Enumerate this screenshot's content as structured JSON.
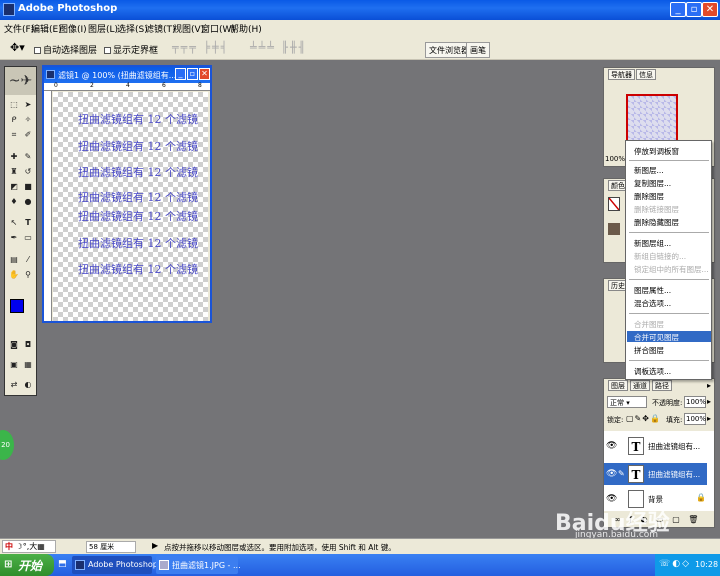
{
  "app": {
    "title": "Adobe Photoshop",
    "icon": "photoshop-icon"
  },
  "menubar": [
    "文件(F)",
    "编辑(E)",
    "图像(I)",
    "图层(L)",
    "选择(S)",
    "滤镜(T)",
    "视图(V)",
    "窗口(W)",
    "帮助(H)"
  ],
  "options": {
    "auto_select_layer": "自动选择图层",
    "show_bounding_box": "显示定界框",
    "tab_file_browser": "文件浏览器",
    "tab_brushes": "画笔"
  },
  "document": {
    "title": "滤镜1 @ 100% (扭曲滤镜组有...",
    "ruler_top": [
      "0",
      "2",
      "4",
      "6",
      "8"
    ],
    "lines": [
      "扭曲滤镜组有 12 个滤镜",
      "扭曲滤镜组有 12 个滤镜",
      "扭曲滤镜组有 12 个滤镜",
      "扭曲滤镜组有 12 个滤镜",
      "扭曲滤镜组有 12 个滤镜",
      "扭曲滤镜组有 12 个滤镜",
      "扭曲滤镜组有 12 个滤镜"
    ]
  },
  "navigator": {
    "tab_navigator": "导航器",
    "tab_info": "信息",
    "zoom": "100%"
  },
  "color_panel": {
    "tab_color": "颜色"
  },
  "history_panel": {
    "tab_history": "历史"
  },
  "context_menu": {
    "items": [
      {
        "label": "停放到调板窗",
        "disabled": false
      },
      {
        "label": "新图层...",
        "disabled": false
      },
      {
        "label": "复制图层...",
        "disabled": false
      },
      {
        "label": "删除图层",
        "disabled": false
      },
      {
        "label": "删除链接图层",
        "disabled": true
      },
      {
        "label": "删除隐藏图层",
        "disabled": false
      },
      {
        "label": "新图层组...",
        "disabled": false
      },
      {
        "label": "新组自链接的...",
        "disabled": true
      },
      {
        "label": "锁定组中的所有图层...",
        "disabled": true
      },
      {
        "label": "图层属性...",
        "disabled": false
      },
      {
        "label": "混合选项...",
        "disabled": false
      },
      {
        "label": "合并图层",
        "disabled": true
      },
      {
        "label": "合并可见图层",
        "disabled": false,
        "highlighted": true
      },
      {
        "label": "拼合图层",
        "disabled": false
      },
      {
        "label": "调板选项...",
        "disabled": false
      }
    ]
  },
  "layers_panel": {
    "tab_layers": "图层",
    "tab_channels": "通道",
    "tab_paths": "路径",
    "blend_mode": "正常",
    "opacity_label": "不透明度:",
    "opacity_value": "100%",
    "lock_label": "锁定:",
    "fill_label": "填充:",
    "fill_value": "100%",
    "layers": [
      {
        "name": "扭曲滤镜组有...",
        "type": "T",
        "selected": false
      },
      {
        "name": "扭曲滤镜组有...",
        "type": "T",
        "selected": true
      },
      {
        "name": "背景",
        "type": "",
        "selected": false
      }
    ]
  },
  "statusbar": {
    "zoom": "58 厘米",
    "hint": "点按并拖移以移动图层或选区。要用附加选项，使用 Shift 和 Alt 键。",
    "ime": "中"
  },
  "taskbar": {
    "start": "开始",
    "items": [
      "Adobe Photoshop",
      "扭曲滤镜1.JPG - ..."
    ],
    "clock": "10:28"
  },
  "watermark": {
    "text": "Baidu经验",
    "url": "jingyan.baidu.com"
  },
  "floating_badge": "20",
  "colors": {
    "titlebar": "#0a5ae6",
    "canvas_text": "#4a4ac8",
    "foreground": "#0000ee",
    "highlight": "#316ac5"
  }
}
